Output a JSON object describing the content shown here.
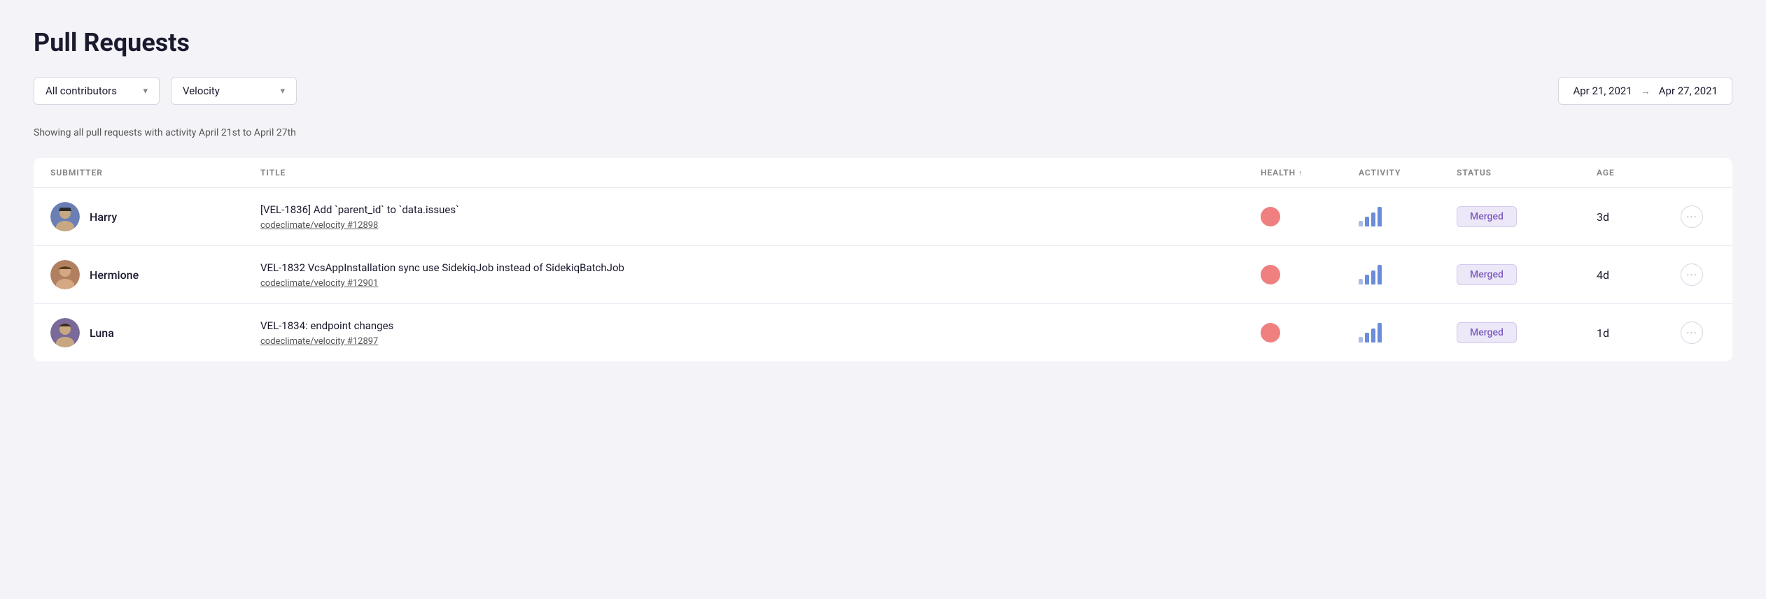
{
  "page": {
    "title": "Pull Requests"
  },
  "filters": {
    "contributor_label": "All contributors",
    "contributor_chevron": "▼",
    "repo_label": "Velocity",
    "repo_chevron": "▼"
  },
  "date_range": {
    "start": "Apr 21, 2021",
    "arrow": "→",
    "end": "Apr 27, 2021"
  },
  "showing_text": "Showing all pull requests with activity April 21st to April 27th",
  "table": {
    "headers": [
      {
        "key": "submitter",
        "label": "SUBMITTER",
        "sort": false
      },
      {
        "key": "title",
        "label": "TITLE",
        "sort": false
      },
      {
        "key": "health",
        "label": "HEALTH",
        "sort": true
      },
      {
        "key": "activity",
        "label": "ACTIVITY",
        "sort": false
      },
      {
        "key": "status",
        "label": "STATUS",
        "sort": false
      },
      {
        "key": "age",
        "label": "AGE",
        "sort": false
      }
    ],
    "rows": [
      {
        "id": "row-1",
        "submitter": "Harry",
        "avatar_style": "harry",
        "title_line1": "[VEL-1836] Add `parent_id` to `data.issues`",
        "title_line2": "codeclimate/velocity #12898",
        "health": "medium",
        "status": "Merged",
        "age": "3d"
      },
      {
        "id": "row-2",
        "submitter": "Hermione",
        "avatar_style": "hermione",
        "title_line1": "VEL-1832 VcsAppInstallation sync use SidekiqJob instead of SidekiqBatchJob",
        "title_line2": "codeclimate/velocity #12901",
        "health": "medium",
        "status": "Merged",
        "age": "4d"
      },
      {
        "id": "row-3",
        "submitter": "Luna",
        "avatar_style": "luna",
        "title_line1": "VEL-1834: endpoint changes",
        "title_line2": "codeclimate/velocity #12897",
        "health": "medium",
        "status": "Merged",
        "age": "1d"
      }
    ]
  },
  "icons": {
    "chevron_down": "▾",
    "sort_up": "↑",
    "arrow_right": "→",
    "more": "···"
  }
}
